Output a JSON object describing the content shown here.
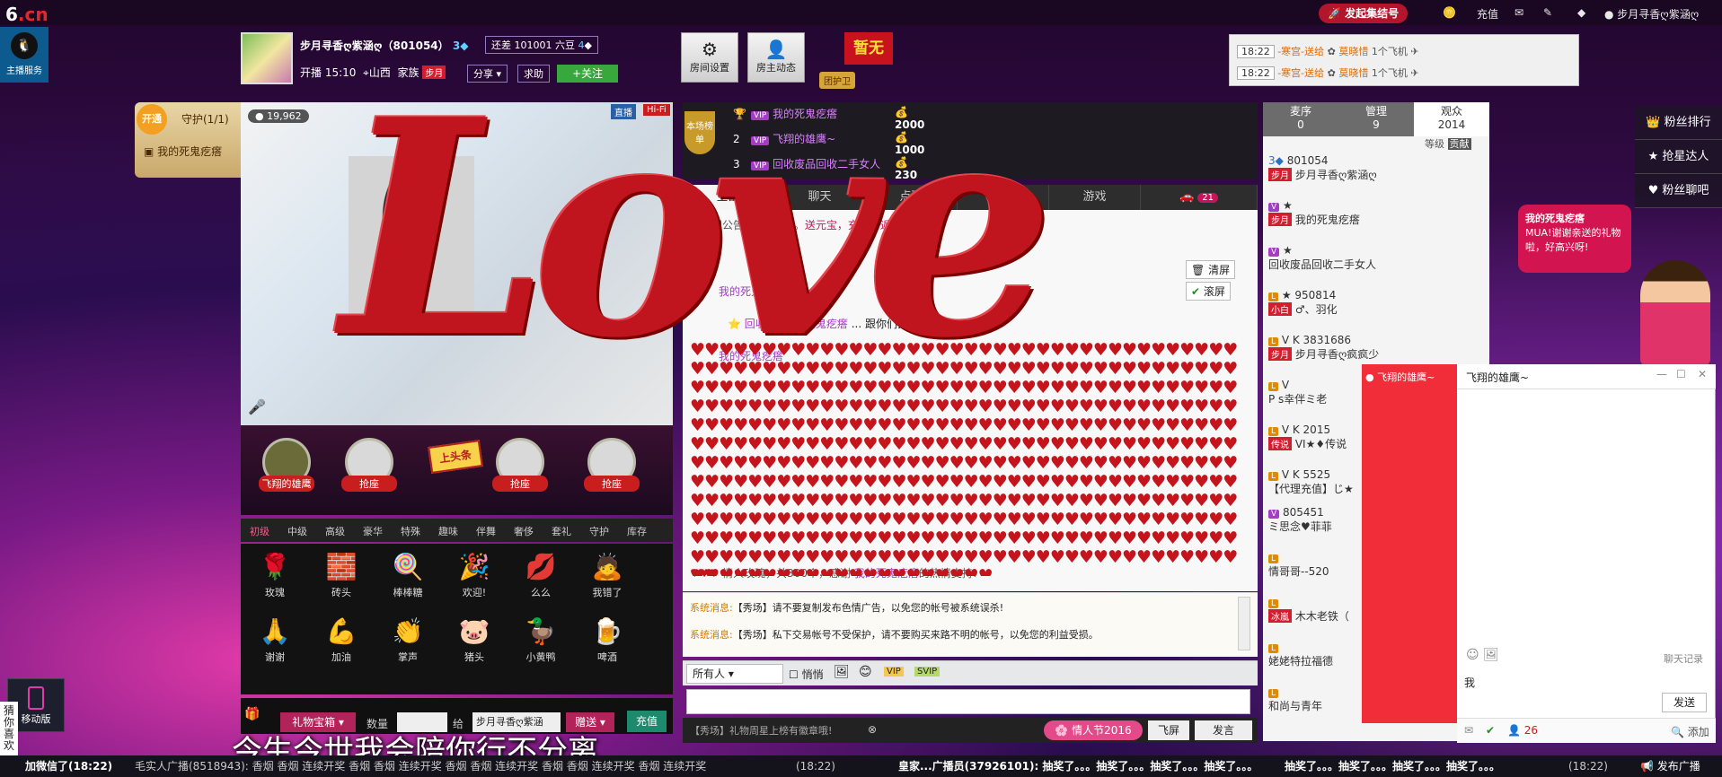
{
  "topbar": {
    "logo_num": "6",
    "logo_cn": ".cn",
    "launch": "发起集结号",
    "recharge": "充值",
    "user": "步月寻香ღ紫涵ღ"
  },
  "service": {
    "label": "主播服务"
  },
  "host": {
    "name": "步月寻香ღ紫涵ღ（801054）",
    "level": "3",
    "coupon": "还差 101001 六豆",
    "coupon_lvl": "4",
    "live_time": "开播 15:10",
    "location": "山西",
    "family_label": "家族",
    "family_tag": "步月",
    "share": "分享",
    "help": "求助",
    "follow": "+关注"
  },
  "room_buttons": {
    "settings": "房间设置",
    "dynamic": "房主动态"
  },
  "flag": {
    "text": "暂无",
    "guard": "团护卫"
  },
  "notices": [
    {
      "time": "18:22",
      "text": "-寒宫-送给",
      "to": "莫晓惜",
      "gift": "1个飞机"
    },
    {
      "time": "18:22",
      "text": "-寒宫-送给",
      "to": "莫晓惜",
      "gift": "1个飞机"
    }
  ],
  "video": {
    "views": "19,962",
    "tag_live": "直播",
    "tag_hifi": "Hi-Fi"
  },
  "guardbox": {
    "open": "开通",
    "label": "守护(1/1)",
    "member": "我的死鬼疙瘩"
  },
  "seats": [
    {
      "label": "飞翔的雄鹰"
    },
    {
      "label": "抢座"
    },
    {
      "label": "抢座"
    },
    {
      "label": "抢座"
    }
  ],
  "headline": "上头条",
  "gift_tabs": [
    "初级",
    "中级",
    "高级",
    "豪华",
    "特殊",
    "趣味",
    "伴舞",
    "奢侈",
    "套礼",
    "守护",
    "库存"
  ],
  "gifts": [
    {
      "name": "玫瑰",
      "icon": "🌹"
    },
    {
      "name": "砖头",
      "icon": "🧱"
    },
    {
      "name": "棒棒糖",
      "icon": "🍭"
    },
    {
      "name": "欢迎!",
      "icon": "🎉"
    },
    {
      "name": "么么",
      "icon": "💋"
    },
    {
      "name": "我错了",
      "icon": "🙇"
    },
    {
      "name": "谢谢",
      "icon": "🙏"
    },
    {
      "name": "加油",
      "icon": "💪"
    },
    {
      "name": "掌声",
      "icon": "👏"
    },
    {
      "name": "猪头",
      "icon": "🐷"
    },
    {
      "name": "小黄鸭",
      "icon": "🦆"
    },
    {
      "name": "啤酒",
      "icon": "🍺"
    }
  ],
  "giftbar": {
    "box": "礼物宝箱",
    "qty": "数量",
    "to": "给",
    "target": "步月寻香ღ紫涵",
    "send": "赠送",
    "charge": "充值"
  },
  "rank": {
    "label": "本场榜单",
    "rows": [
      {
        "n": "",
        "name": "我的死鬼疙瘩",
        "v": "2000"
      },
      {
        "n": "2",
        "name": "飞翔的雄鹰~",
        "v": "1000"
      },
      {
        "n": "3",
        "name": "回收废品回收二手女人",
        "v": "230"
      }
    ]
  },
  "chat_tabs": [
    "全部",
    "聊天",
    "点歌",
    "礼物",
    "游戏"
  ],
  "chat_tab_badge": "21",
  "chat": {
    "announce_label": "【房间公告】:",
    "announce": "挂爱管。送元宝，充值有返点。",
    "clear": "清屏",
    "scroll": "滚屏",
    "l1": "我的死鬼疙瘩",
    "l2a": "回收",
    "l2b": "我的死鬼疙瘩",
    "l2c": "跟你们抢了",
    "l3": "我的死鬼疙瘩",
    "l4a": "情人玫瑰，共300个，感谢",
    "l4b": "我的死鬼疙瘩",
    "l4c": "的热情支持!"
  },
  "sys": [
    {
      "k": "系统消息:",
      "t": "【秀场】请不要复制发布色情广告，以免您的帐号被系统误杀!"
    },
    {
      "k": "系统消息:",
      "t": "【秀场】私下交易帐号不受保护，请不要购买来路不明的帐号，以免您的利益受损。"
    }
  ],
  "inbar": {
    "target": "所有人",
    "whisper": "悄悄"
  },
  "sendrow": {
    "tip": "【秀场】礼物周星上榜有徽章哦!",
    "valentine": "情人节2016",
    "fly": "飞屏",
    "send": "发言"
  },
  "ptabs": [
    {
      "t": "麦序",
      "c": "0"
    },
    {
      "t": "管理",
      "c": "9"
    },
    {
      "t": "观众",
      "c": "2014"
    }
  ],
  "ptab_sub": {
    "lvl": "等级",
    "contrib": "贡献"
  },
  "users": [
    {
      "id": "801054",
      "tag": "步月",
      "name": "步月寻香ღ紫涵ღ"
    },
    {
      "id": "",
      "tag": "步月",
      "name": "我的死鬼疙瘩"
    },
    {
      "id": "",
      "tag": "",
      "name": "回收废品回收二手女人"
    },
    {
      "id": "950814",
      "tag": "小白",
      "name": "♂、羽化"
    },
    {
      "id": "3831686",
      "tag": "步月",
      "name": "步月寻香ღ疯疯少"
    },
    {
      "id": "",
      "tag": "",
      "name": "P s幸伴ミ老"
    },
    {
      "id": "2015",
      "tag": "传说",
      "name": "VI★♦传说"
    },
    {
      "id": "5525",
      "tag": "",
      "name": "【代理充值】じ★"
    },
    {
      "id": "805451",
      "tag": "",
      "name": "ミ思念♥菲菲"
    },
    {
      "id": "",
      "tag": "",
      "name": "情哥哥--520"
    },
    {
      "id": "",
      "tag": "冰嵐",
      "name": "木木老铁（"
    },
    {
      "id": "",
      "tag": "",
      "name": "姥姥特拉福德"
    },
    {
      "id": "",
      "tag": "",
      "name": "和尚与青年"
    }
  ],
  "sidemenu": [
    "粉丝排行",
    "抢星达人",
    "粉丝聊吧"
  ],
  "bubble": {
    "name": "我的死鬼疙瘩",
    "text": "MUA!谢谢亲送的礼物啦，好高兴呀!"
  },
  "pchat": {
    "left_name": "飞翔的雄鹰~",
    "title": "飞翔的雄鹰~",
    "history": "聊天记录",
    "msg": "我",
    "send": "发送",
    "count": "26",
    "add": "添加"
  },
  "mobile": "移动版",
  "guess": "猜你喜欢",
  "subtitle": "今生今世我会陪你行不分离",
  "love_text": "Love",
  "ticker": {
    "a": "加微信了(18:22)",
    "b": "毛实人广播(8518943): 香烟 香烟 连续开奖 香烟 香烟 连续开奖 香烟 香烟 连续开奖 香烟 香烟 连续开奖 香烟 连续开奖",
    "c": "(18:22)",
    "d": "皇家...广播员(37926101): 抽奖了。。。抽奖了。。。抽奖了。。。抽奖了。。。",
    "e": "抽奖了。。。抽奖了。。。抽奖了。。。抽奖了。。。",
    "f": "(18:22)",
    "g": "发布广播"
  }
}
